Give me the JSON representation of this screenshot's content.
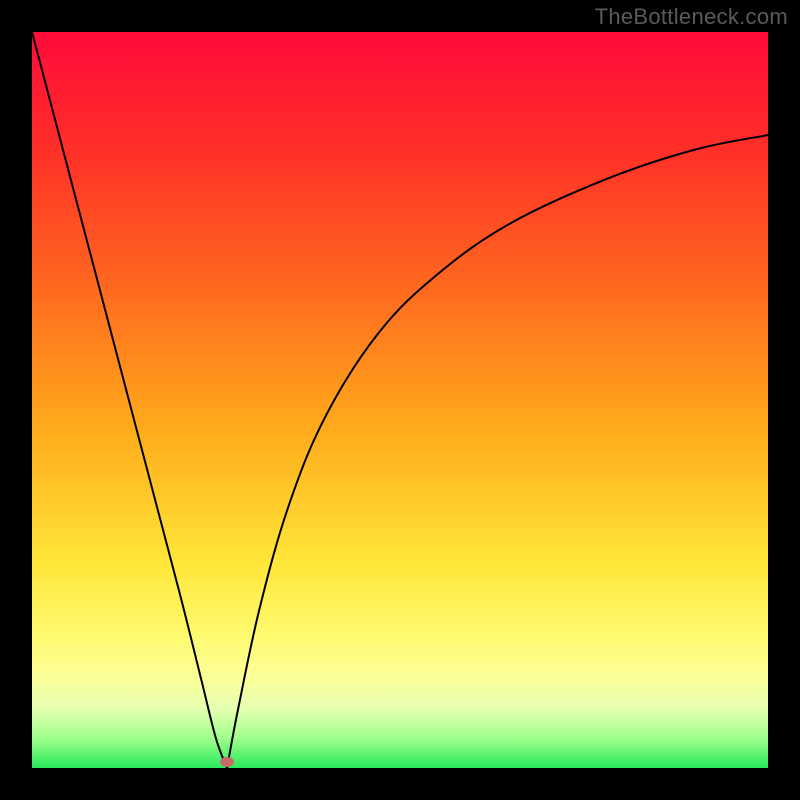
{
  "site_label": "TheBottleneck.com",
  "chart_data": {
    "type": "line",
    "title": "",
    "xlabel": "",
    "ylabel": "",
    "xlim": [
      0,
      100
    ],
    "ylim": [
      0,
      100
    ],
    "series": [
      {
        "name": "left-branch",
        "x": [
          0,
          5,
          10,
          15,
          20,
          23,
          25,
          26.5
        ],
        "y": [
          100,
          81,
          62,
          43,
          24,
          12,
          4,
          0
        ]
      },
      {
        "name": "right-branch",
        "x": [
          26.5,
          28,
          31,
          35,
          40,
          47,
          55,
          65,
          78,
          90,
          100
        ],
        "y": [
          0,
          8,
          22,
          36,
          48,
          59,
          67,
          74,
          80,
          84,
          86
        ]
      }
    ],
    "marker": {
      "x": 26.5,
      "y": 0.8,
      "color": "#c76a6a"
    },
    "gradient_stops": [
      {
        "pos": 0,
        "color": "#ff0a3a"
      },
      {
        "pos": 16,
        "color": "#ff2f28"
      },
      {
        "pos": 35,
        "color": "#ff6a1f"
      },
      {
        "pos": 55,
        "color": "#ffae1c"
      },
      {
        "pos": 72,
        "color": "#ffe638"
      },
      {
        "pos": 82,
        "color": "#fffb70"
      },
      {
        "pos": 88,
        "color": "#fcff9a"
      },
      {
        "pos": 92,
        "color": "#e5ffb2"
      },
      {
        "pos": 96,
        "color": "#9dff8a"
      },
      {
        "pos": 100,
        "color": "#29e85c"
      }
    ]
  }
}
